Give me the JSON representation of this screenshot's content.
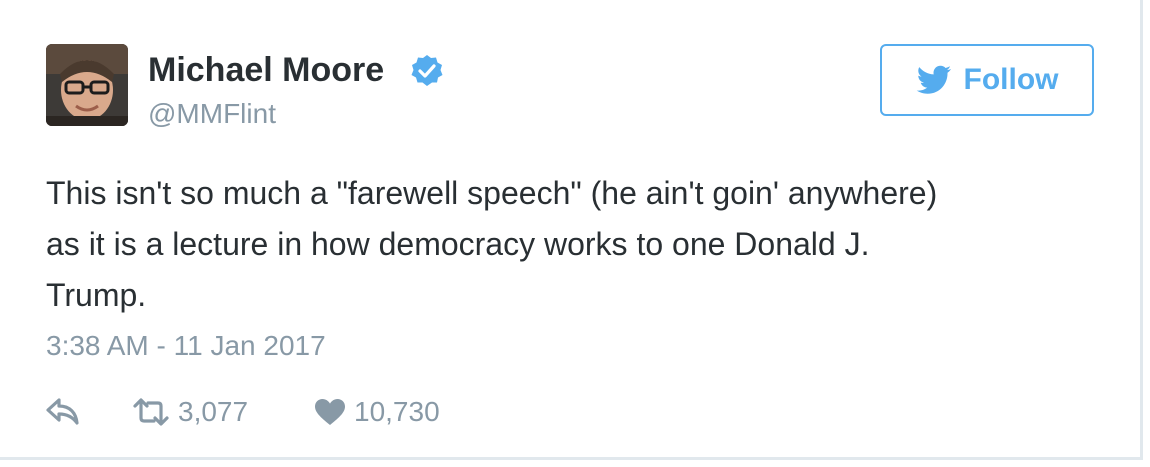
{
  "tweet": {
    "author": {
      "name": "Michael Moore",
      "handle": "@MMFlint",
      "verified": true,
      "avatar_icon": "avatar-photo"
    },
    "follow_button": {
      "label": "Follow",
      "icon": "twitter-bird-icon"
    },
    "text_lines": [
      "This isn't so much a \"farewell speech\" (he ain't goin' anywhere)",
      "as it is a lecture in how democracy works to one Donald J.",
      "Trump."
    ],
    "timestamp": "3:38 AM - 11 Jan 2017",
    "actions": {
      "reply_icon": "reply-icon",
      "retweet_icon": "retweet-icon",
      "retweet_count": "3,077",
      "like_icon": "heart-icon",
      "like_count": "10,730"
    }
  },
  "colors": {
    "text": "#292f33",
    "muted": "#8899a6",
    "accent": "#55acee",
    "border": "#e1e8ed"
  }
}
